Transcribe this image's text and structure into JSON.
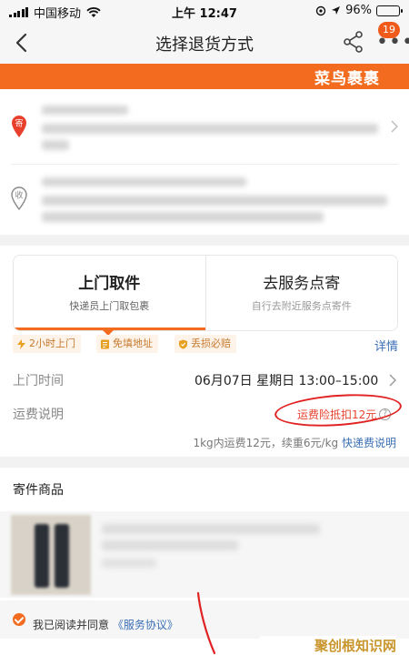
{
  "status_bar": {
    "carrier": "中国移动",
    "time": "上午 12:47",
    "battery": "96%",
    "battery_level": 0.96
  },
  "nav": {
    "title": "选择退货方式",
    "badge": "19"
  },
  "banner": {
    "brand": "菜鸟裹裹"
  },
  "address": {
    "sender_icon_label": "寄",
    "receiver_icon_label": "收"
  },
  "method": {
    "tabs": [
      {
        "title": "上门取件",
        "subtitle": "快递员上门取包裹"
      },
      {
        "title": "去服务点寄",
        "subtitle": "自行去附近服务点寄件"
      }
    ],
    "features": [
      "2小时上门",
      "免填地址",
      "丢损必赔"
    ],
    "detail_link": "详情",
    "pickup_time_label": "上门时间",
    "pickup_time_value": "06月07日 星期日 13:00–15:00",
    "fee_label": "运费说明",
    "insurance": "运费险抵扣12元",
    "help": "?",
    "fee_note": "1kg内运费12元，续重6元/kg",
    "fee_link": "快递费说明"
  },
  "goods": {
    "title": "寄件商品"
  },
  "agreement": {
    "text": "我已阅读并同意",
    "link": "《服务协议》"
  },
  "watermark": "聚创根知识网",
  "colors": {
    "accent": "#f26b1f",
    "link": "#3a6fb5",
    "highlight": "#e12222"
  }
}
